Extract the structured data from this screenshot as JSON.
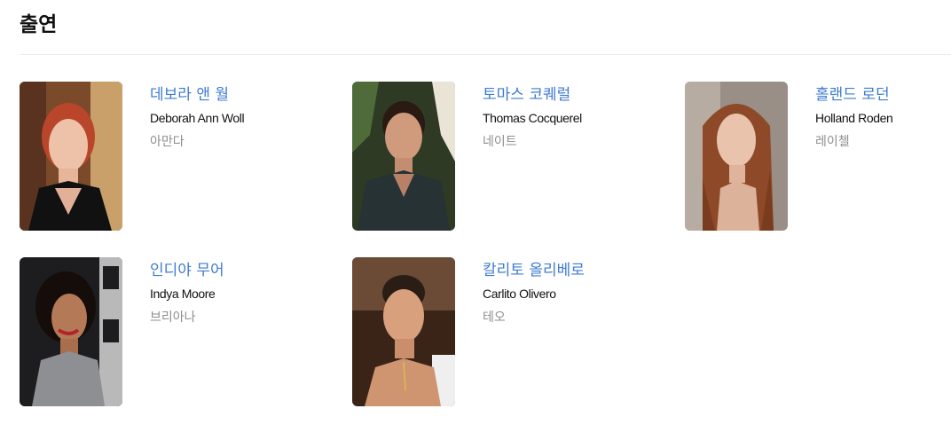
{
  "section": {
    "title": "출연"
  },
  "cast": [
    {
      "name_ko": "데보라 앤 월",
      "name_en": "Deborah Ann Woll",
      "role": "아만다"
    },
    {
      "name_ko": "토마스 코퀘럴",
      "name_en": "Thomas Cocquerel",
      "role": "네이트"
    },
    {
      "name_ko": "홀랜드 로던",
      "name_en": "Holland Roden",
      "role": "레이첼"
    },
    {
      "name_ko": "인디야 무어",
      "name_en": "Indya Moore",
      "role": "브리아나"
    },
    {
      "name_ko": "칼리토 올리베로",
      "name_en": "Carlito Olivero",
      "role": "테오"
    }
  ]
}
